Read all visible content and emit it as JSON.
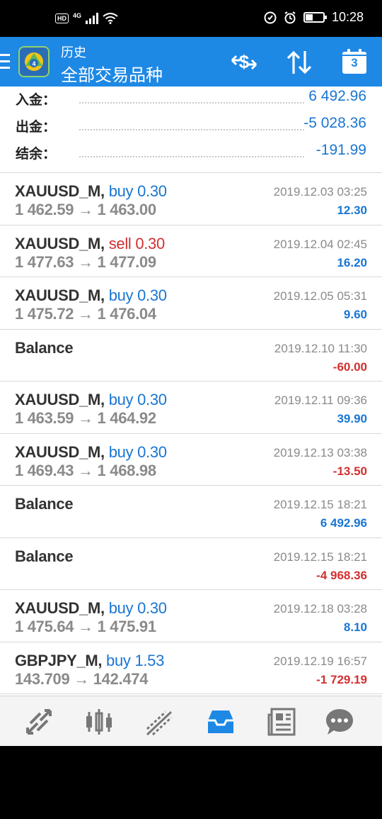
{
  "status_bar": {
    "hd": "HD",
    "network": "4G",
    "time": "10:28"
  },
  "app_bar": {
    "title_top": "历史",
    "title_main": "全部交易品种",
    "calendar_day": "3"
  },
  "summary": [
    {
      "label": "入金：",
      "value": "6 492.96"
    },
    {
      "label": "出金：",
      "value": "-5 028.36"
    },
    {
      "label": "结余：",
      "value": "-191.99"
    }
  ],
  "deals": [
    {
      "symbol": "XAUUSD_M,",
      "type": "buy",
      "volume": "0.30",
      "prices": "1 462.59 → 1 463.00",
      "time": "2019.12.03 03:25",
      "profit": "12.30"
    },
    {
      "symbol": "XAUUSD_M,",
      "type": "sell",
      "volume": "0.30",
      "prices": "1 477.63 → 1 477.09",
      "time": "2019.12.04 02:45",
      "profit": "16.20"
    },
    {
      "symbol": "XAUUSD_M,",
      "type": "buy",
      "volume": "0.30",
      "prices": "1 475.72 → 1 476.04",
      "time": "2019.12.05 05:31",
      "profit": "9.60"
    },
    {
      "symbol": "Balance",
      "type": "",
      "volume": "",
      "prices": "",
      "time": "2019.12.10 11:30",
      "profit": "-60.00"
    },
    {
      "symbol": "XAUUSD_M,",
      "type": "buy",
      "volume": "0.30",
      "prices": "1 463.59 → 1 464.92",
      "time": "2019.12.11 09:36",
      "profit": "39.90"
    },
    {
      "symbol": "XAUUSD_M,",
      "type": "buy",
      "volume": "0.30",
      "prices": "1 469.43 → 1 468.98",
      "time": "2019.12.13 03:38",
      "profit": "-13.50"
    },
    {
      "symbol": "Balance",
      "type": "",
      "volume": "",
      "prices": "",
      "time": "2019.12.15 18:21",
      "profit": "6 492.96"
    },
    {
      "symbol": "Balance",
      "type": "",
      "volume": "",
      "prices": "",
      "time": "2019.12.15 18:21",
      "profit": "-4 968.36"
    },
    {
      "symbol": "XAUUSD_M,",
      "type": "buy",
      "volume": "0.30",
      "prices": "1 475.64 → 1 475.91",
      "time": "2019.12.18 03:28",
      "profit": "8.10"
    },
    {
      "symbol": "GBPJPY_M,",
      "type": "buy",
      "volume": "1.53",
      "prices": "143.709 → 142.474",
      "time": "2019.12.19 16:57",
      "profit": "-1 729.19"
    }
  ],
  "colors": {
    "accent": "#1e88e5",
    "positive": "#1976d2",
    "negative": "#d32f2f",
    "muted": "#8a8a8a"
  },
  "bottom_nav": [
    {
      "name": "quotes",
      "icon": "quotes-arrows-icon",
      "active": false
    },
    {
      "name": "chart",
      "icon": "candlestick-icon",
      "active": false
    },
    {
      "name": "trade",
      "icon": "trade-trend-icon",
      "active": false
    },
    {
      "name": "history",
      "icon": "history-inbox-icon",
      "active": true
    },
    {
      "name": "news",
      "icon": "newspaper-icon",
      "active": false
    },
    {
      "name": "messages",
      "icon": "chat-icon",
      "active": false
    }
  ]
}
